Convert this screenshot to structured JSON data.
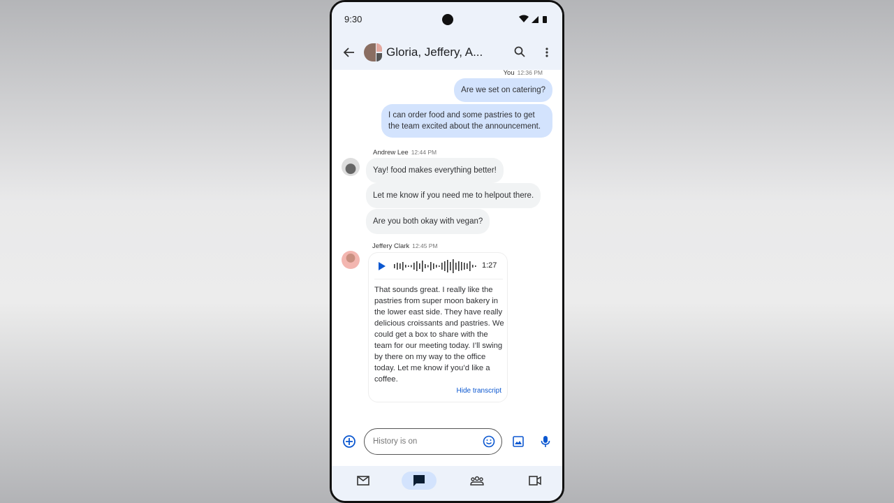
{
  "status": {
    "time": "9:30"
  },
  "header": {
    "title": "Gloria, Jeffery, A...",
    "back_icon": "arrow-back-icon",
    "search_icon": "search-icon",
    "menu_icon": "more-vert-icon"
  },
  "messages": {
    "you_meta": {
      "sender": "You",
      "time": "12:36 PM"
    },
    "you": [
      "Are we set on catering?",
      "I can order food and some pastries to get the team excited about the announcement."
    ],
    "andrew_meta": {
      "sender": "Andrew Lee",
      "time": "12:44 PM"
    },
    "andrew": [
      "Yay! food makes everything better!",
      "Let me know if you need me to helpout there.",
      "Are you both okay with vegan?"
    ],
    "jeffery_meta": {
      "sender": "Jeffery Clark",
      "time": "12:45 PM"
    },
    "voice": {
      "duration": "1:27",
      "transcript": "That sounds great. I really like the pastries from super moon bakery in the lower east side. They have really delicious croissants and pastries. We could get a box to share with the team for our meeting today. I’ll swing by there on my way to the office today. Let me know if you’d like a coffee.",
      "hide_label": "Hide transcript"
    }
  },
  "composer": {
    "placeholder": "History is on"
  },
  "nav": [
    "mail",
    "chat",
    "spaces",
    "meet"
  ],
  "colors": {
    "accent": "#0b57d0",
    "sent_bubble": "#d3e3fd",
    "received_bubble": "#f1f3f4",
    "surface": "#edf2fa"
  }
}
